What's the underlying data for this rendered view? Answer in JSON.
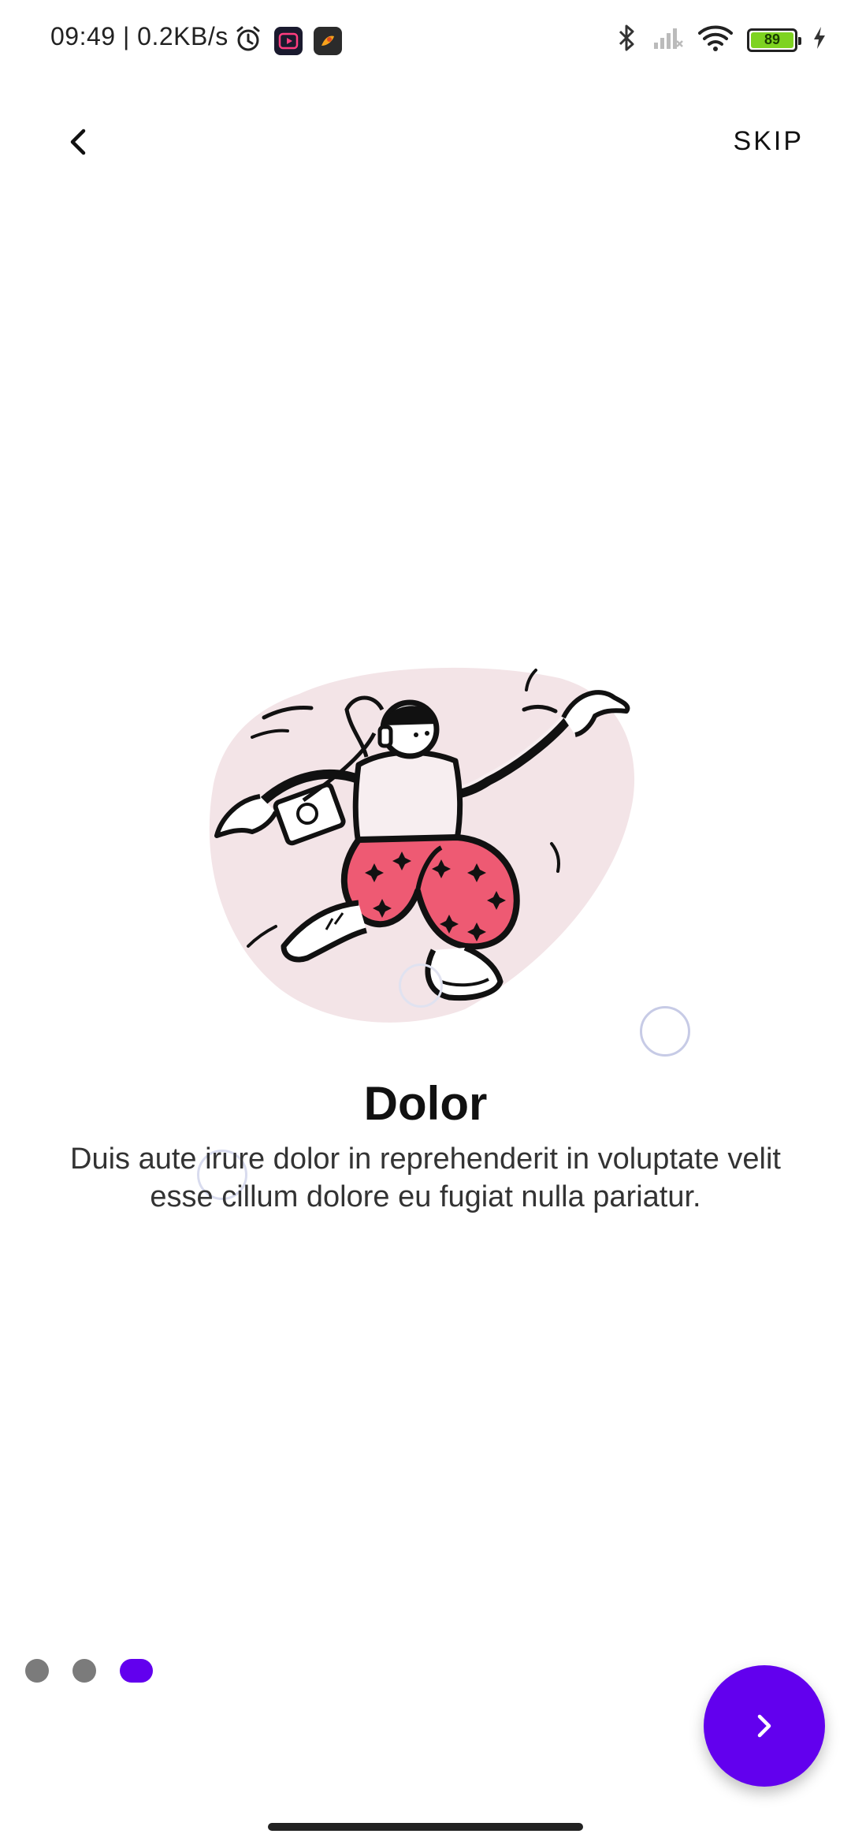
{
  "status_bar": {
    "time": "09:49 | 0.2KB/s",
    "battery_level": "89",
    "icons": [
      "alarm-icon",
      "video-app-icon",
      "game-app-icon",
      "bluetooth-icon",
      "signal-icon",
      "wifi-icon",
      "battery-icon",
      "charging-icon"
    ]
  },
  "nav": {
    "back_icon": "chevron-left-icon",
    "skip_label": "SKIP"
  },
  "slide": {
    "illustration": "dancing-person-illustration",
    "title": "Dolor",
    "description": "Duis aute irure dolor in reprehenderit in voluptate velit esse cillum dolore eu fugiat nulla pariatur."
  },
  "pager": {
    "count": 3,
    "active_index": 2
  },
  "fab": {
    "icon": "chevron-right-icon"
  },
  "colors": {
    "accent": "#6200ee",
    "inactive_dot": "#7b7b7b",
    "blob": "#f3e4e7",
    "pants": "#ee5a73"
  }
}
